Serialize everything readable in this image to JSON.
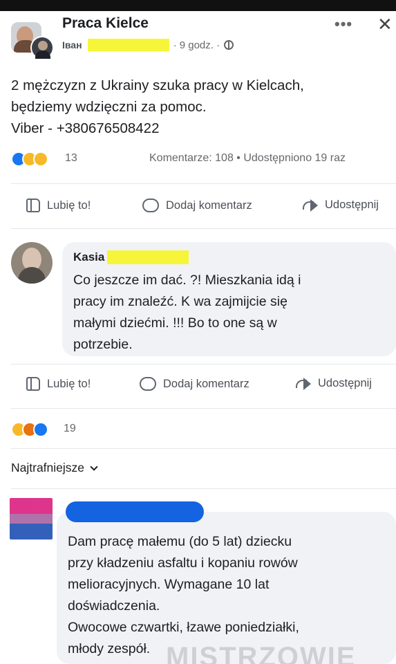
{
  "post": {
    "group_name": "Praca Kielce",
    "author": "Іван",
    "time": "· 9 godz. ·",
    "more_label": "•••",
    "close_label": "✕",
    "body_lines": [
      "2 mężczyzn z Ukrainy szuka pracy w Kielcach,",
      "będziemy wdzięczni za pomoc.",
      "Viber - +380676508422"
    ],
    "reaction_count": "13",
    "stats": "Komentarze: 108 • Udostępniono 19 raz"
  },
  "actions": {
    "like": "Lubię to!",
    "comment": "Dodaj komentarz",
    "share": "Udostępnij"
  },
  "comment1": {
    "author": "Kasia",
    "text_lines": [
      "Co jeszcze im dać. ?! Mieszkania idą i",
      "pracy im znaleźć. K     wa zajmijcie się",
      "małymi dziećmi. !!! Bo to one są w",
      "potrzebie."
    ],
    "reaction_count": "19"
  },
  "sort_label": "Najtrafniejsze",
  "comment2": {
    "text_lines": [
      "Dam pracę małemu (do 5 lat) dziecku",
      "przy kładzeniu asfaltu i kopaniu rowów",
      "melioracyjnych. Wymagane 10 lat",
      "doświadczenia.",
      "Owocowe czwartki, łzawe poniedziałki,",
      "młody zespół."
    ]
  },
  "watermark": "MISTRZOWIE",
  "icons": {
    "like": "thumbs-up-icon",
    "comment": "speech-bubble-icon",
    "share": "share-arrow-icon",
    "privacy": "globe-icon",
    "sort": "chevron-down-icon"
  },
  "colors": {
    "redaction_yellow": "#f6f53a",
    "redaction_blue": "#1463e0",
    "bubble_bg": "#f0f2f5",
    "like_blue": "#1877f2"
  }
}
